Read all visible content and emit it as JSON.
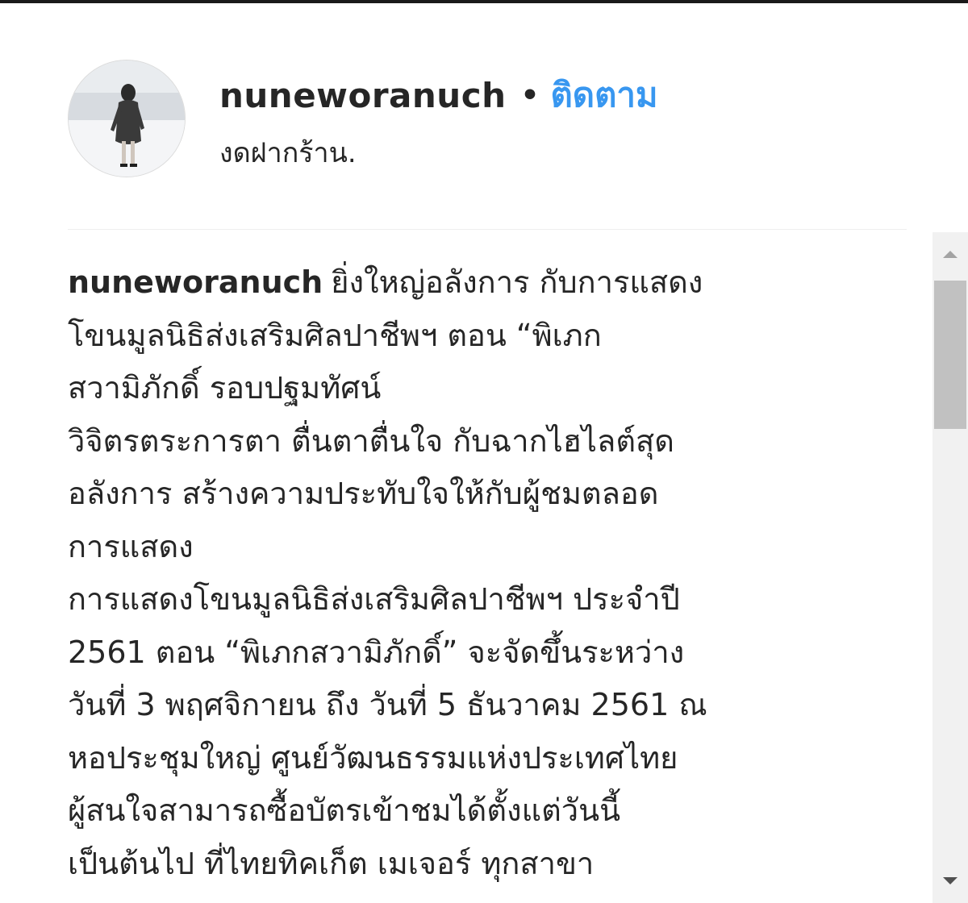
{
  "post": {
    "username": "nuneworanuch",
    "separator": "•",
    "follow_label": "ติดตาม",
    "location": "งดฝากร้าน."
  },
  "caption": {
    "username": "nuneworanuch",
    "lines": [
      "ยิ่งใหญ่อลังการ กับการแสดง",
      "โขนมูลนิธิส่งเสริมศิลปาชีพฯ ตอน “พิเภก",
      "สวามิภักดิ์ รอบปฐมทัศน์",
      "วิจิตรตระการตา ตื่นตาตื่นใจ กับฉากไฮไลต์สุด",
      "อลังการ สร้างความประทับใจให้กับผู้ชมตลอด",
      "การแสดง",
      "การแสดงโขนมูลนิธิส่งเสริมศิลปาชีพฯ ประจำปี",
      "2561 ตอน “พิเภกสวามิภักดิ์” จะจัดขึ้นระหว่าง",
      "วันที่ 3 พฤศจิกายน ถึง วันที่ 5 ธันวาคม 2561 ณ",
      "หอประชุมใหญ่ ศูนย์วัฒนธรรมแห่งประเทศไทย",
      "ผู้สนใจสามารถซื้อบัตรเข้าชมได้ตั้งแต่วันนี้",
      "เป็นต้นไป ที่ไทยทิคเก็ต เมเจอร์ ทุกสาขา"
    ]
  },
  "icons": {
    "scroll_up": "scroll-up-arrow-icon",
    "scroll_down": "scroll-down-arrow-icon"
  },
  "colors": {
    "follow": "#3897f0",
    "text": "#262626",
    "scrollbar_track": "#f1f1f1",
    "scrollbar_thumb": "#c1c1c1"
  }
}
